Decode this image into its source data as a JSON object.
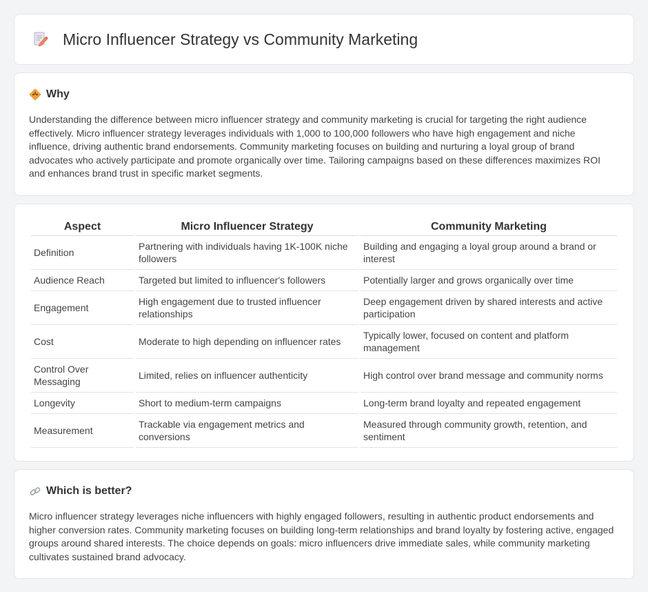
{
  "header": {
    "title": "Micro Influencer Strategy vs Community Marketing",
    "icon": "document-edit-icon"
  },
  "why": {
    "heading": "Why",
    "icon": "diamond-warning-icon",
    "text": "Understanding the difference between micro influencer strategy and community marketing is crucial for targeting the right audience effectively. Micro influencer strategy leverages individuals with 1,000 to 100,000 followers who have high engagement and niche influence, driving authentic brand endorsements. Community marketing focuses on building and nurturing a loyal group of brand advocates who actively participate and promote organically over time. Tailoring campaigns based on these differences maximizes ROI and enhances brand trust in specific market segments."
  },
  "table": {
    "headers": [
      "Aspect",
      "Micro Influencer Strategy",
      "Community Marketing"
    ],
    "rows": [
      {
        "aspect": "Definition",
        "micro": "Partnering with individuals having 1K-100K niche followers",
        "community": "Building and engaging a loyal group around a brand or interest"
      },
      {
        "aspect": "Audience Reach",
        "micro": "Targeted but limited to influencer's followers",
        "community": "Potentially larger and grows organically over time"
      },
      {
        "aspect": "Engagement",
        "micro": "High engagement due to trusted influencer relationships",
        "community": "Deep engagement driven by shared interests and active participation"
      },
      {
        "aspect": "Cost",
        "micro": "Moderate to high depending on influencer rates",
        "community": "Typically lower, focused on content and platform management"
      },
      {
        "aspect": "Control Over Messaging",
        "micro": "Limited, relies on influencer authenticity",
        "community": "High control over brand message and community norms"
      },
      {
        "aspect": "Longevity",
        "micro": "Short to medium-term campaigns",
        "community": "Long-term brand loyalty and repeated engagement"
      },
      {
        "aspect": "Measurement",
        "micro": "Trackable via engagement metrics and conversions",
        "community": "Measured through community growth, retention, and sentiment"
      }
    ]
  },
  "better": {
    "heading": "Which is better?",
    "icon": "link-icon",
    "text": "Micro influencer strategy leverages niche influencers with highly engaged followers, resulting in authentic product endorsements and higher conversion rates. Community marketing focuses on building long-term relationships and brand loyalty by fostering active, engaged groups around shared interests. The choice depends on goals: micro influencers drive immediate sales, while community marketing cultivates sustained brand advocacy."
  }
}
